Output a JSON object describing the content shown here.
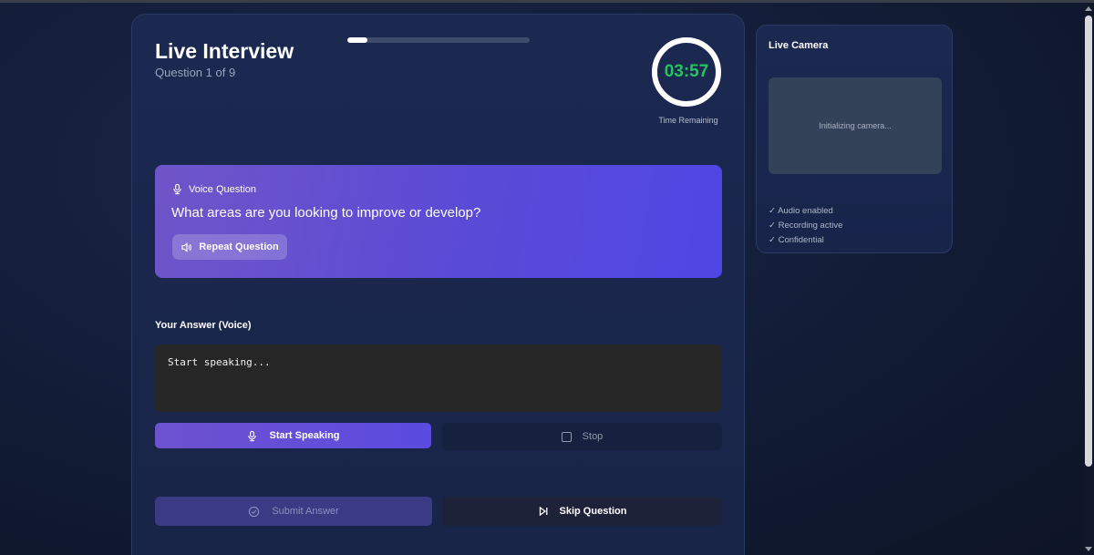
{
  "header": {
    "title": "Live Interview",
    "subtitle": "Question 1 of 9",
    "progress_fraction": 0.11
  },
  "timer": {
    "value": "03:57",
    "label": "Time Remaining",
    "color": "#22c55e"
  },
  "question": {
    "heading": "Voice Question",
    "text": "What areas are you looking to improve or develop?",
    "repeat_label": "Repeat Question",
    "gradient": [
      "#6f55c8",
      "#4f46e5"
    ]
  },
  "answer": {
    "label": "Your Answer (Voice)",
    "placeholder": "Start speaking..."
  },
  "controls": {
    "start_label": "Start Speaking",
    "stop_label": "Stop",
    "submit_label": "Submit Answer",
    "skip_label": "Skip Question"
  },
  "camera": {
    "title": "Live Camera",
    "status_text": "Initializing camera...",
    "checks": [
      "✓ Audio enabled",
      "✓ Recording active",
      "✓ Confidential"
    ]
  },
  "icons": {
    "question": "microphone-icon",
    "repeat": "speaker-icon",
    "start": "microphone-icon",
    "stop": "stop-square-icon",
    "submit": "check-circle-icon",
    "skip": "skip-forward-icon"
  }
}
